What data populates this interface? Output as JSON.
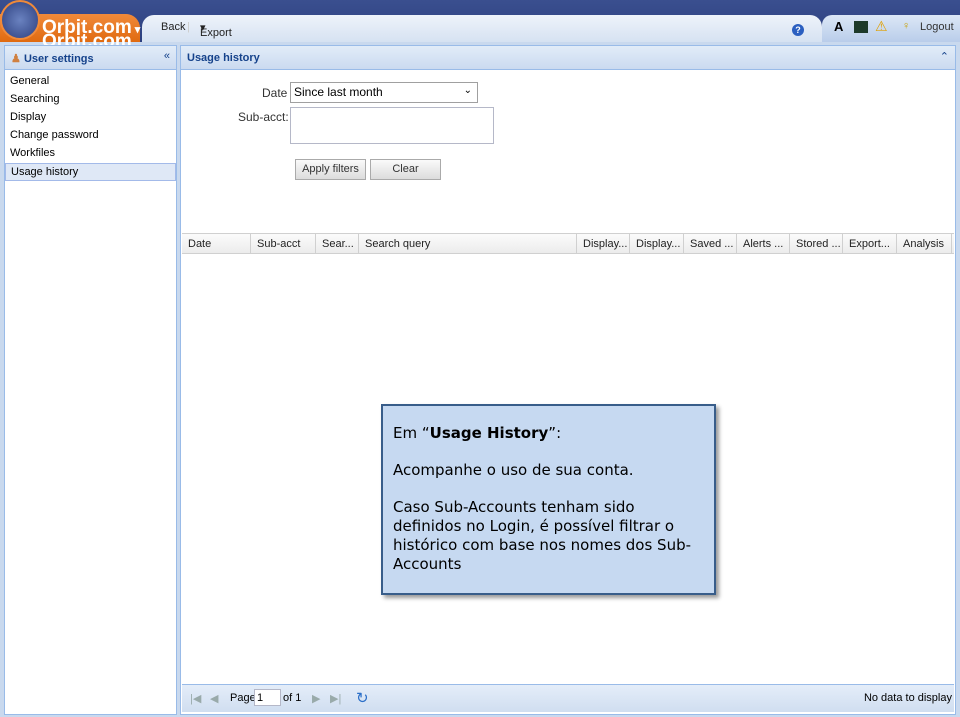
{
  "header": {
    "logo": "Orbit.com",
    "back": "Back",
    "export": "Export",
    "logout": "Logout"
  },
  "sidebar": {
    "title": "User settings",
    "items": [
      {
        "label": "General"
      },
      {
        "label": "Searching"
      },
      {
        "label": "Display"
      },
      {
        "label": "Change password"
      },
      {
        "label": "Workfiles"
      },
      {
        "label": "Usage history",
        "selected": true
      }
    ]
  },
  "main": {
    "title": "Usage history",
    "filters": {
      "date_label": "Date",
      "date_value": "Since last month",
      "subacct_label": "Sub-acct:",
      "subacct_value": "",
      "apply": "Apply filters",
      "clear": "Clear"
    },
    "columns": [
      "Date",
      "Sub-acct",
      "Sear...",
      "Search query",
      "Display...",
      "Display...",
      "Saved ...",
      "Alerts ...",
      "Stored ...",
      "Export...",
      "Analysis"
    ],
    "pager": {
      "page_label": "Page",
      "page_value": "1",
      "of_label": "of 1",
      "status": "No data to display"
    }
  },
  "callout": {
    "intro": "Em ",
    "title": "Usage History",
    "suffix": ":",
    "line1": "Acompanhe o uso de sua conta.",
    "line2": "Caso Sub-Accounts tenham sido definidos no Login, é possível filtrar o histórico com base nos nomes dos Sub-Accounts"
  }
}
